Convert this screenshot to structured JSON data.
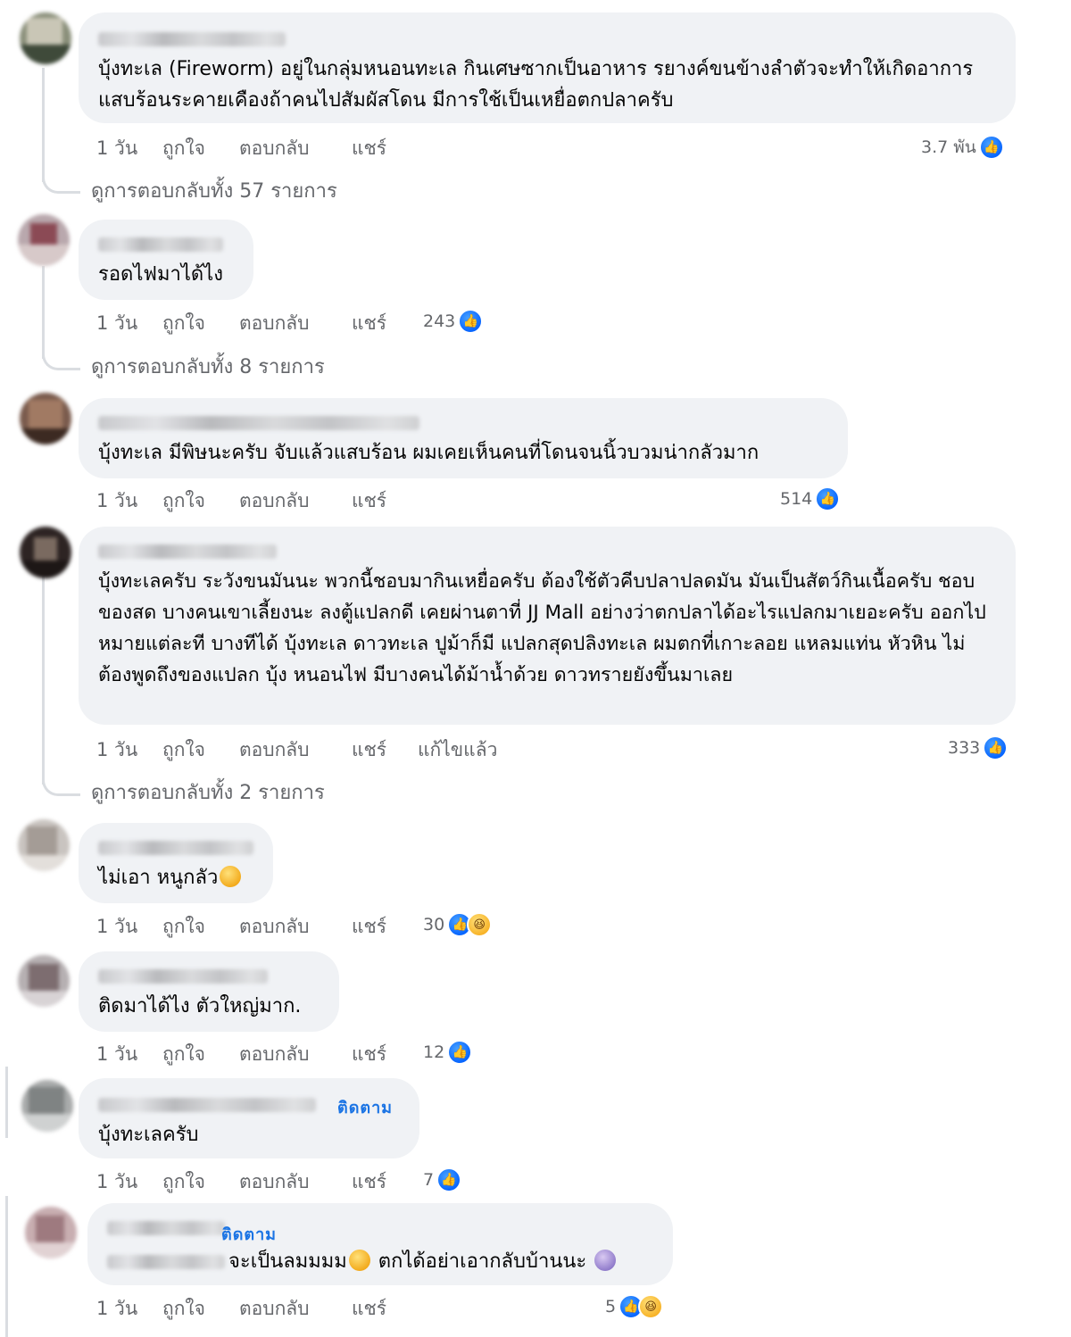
{
  "actions": {
    "time": "1 วัน",
    "like": "ถูกใจ",
    "reply": "ตอบกลับ",
    "share": "แชร์",
    "edited": "แก้ไขแล้ว"
  },
  "colors": {
    "bubble": "#f0f2f5",
    "accent": "#1b74e4",
    "muted_text": "#65676b",
    "like_blue": "#0866ff",
    "haha_yellow": "#f7b125"
  },
  "comments": [
    {
      "text": "บุ้งทะเล (Fireworm) อยู่ในกลุ่มหนอนทะเล กินเศษซากเป็นอาหาร รยางค์ขนข้างลำตัวจะทำให้เกิดอาการแสบร้อนระคายเคืองถ้าคนไปสัมผัสโดน มีการใช้เป็นเหยื่อตกปลาครับ",
      "reaction_count": "3.7 พัน",
      "reactions": [
        "like-icon"
      ],
      "view_replies": "ดูการตอบกลับทั้ง 57 รายการ"
    },
    {
      "text": "รอดไฟมาได้ไง",
      "reaction_count": "243",
      "reactions": [
        "like-icon"
      ],
      "view_replies": "ดูการตอบกลับทั้ง 8 รายการ"
    },
    {
      "text": "บุ้งทะเล มีพิษนะครับ จับแล้วแสบร้อน ผมเคยเห็นคนที่โดนจนนิ้วบวมน่ากลัวมาก",
      "reaction_count": "514",
      "reactions": [
        "like-icon"
      ]
    },
    {
      "text": "บุ้งทะเลครับ ระวังขนมันนะ พวกนี้ชอบมากินเหยื่อครับ ต้องใช้ตัวคีบปลาปลดมัน มันเป็นสัตว์กินเนื้อครับ ชอบของสด บางคนเขาเลี้ยงนะ ลงตู้แปลกดี เคยผ่านตาที่ JJ Mall อย่างว่าตกปลาได้อะไรแปลกมาเยอะครับ ออกไปหมายแต่ละที บางทีได้ บุ้งทะเล ดาวทะเล ปูม้าก็มี แปลกสุดปลิงทะเล ผมตกที่เกาะลอย แหลมแท่น หัวหิน ไม่ต้องพูดถึงของแปลก บุ้ง หนอนไฟ มีบางคนได้ม้าน้ำด้วย ดาวทรายยังขึ้นมาเลย",
      "reaction_count": "333",
      "reactions": [
        "like-icon"
      ],
      "edited": true,
      "view_replies": "ดูการตอบกลับทั้ง 2 รายการ"
    },
    {
      "text": "ไม่เอา หนูกลัว",
      "emoji_after": "rofl-emoji",
      "reaction_count": "30",
      "reactions": [
        "like-icon",
        "haha-icon"
      ]
    },
    {
      "text": "ติดมาได้ไง ตัวใหญ่มาก.",
      "reaction_count": "12",
      "reactions": [
        "like-icon"
      ]
    },
    {
      "text": "บุ้งทะเลครับ",
      "follow_label": "ติดตาม",
      "reaction_count": "7",
      "reactions": [
        "like-icon"
      ]
    },
    {
      "text_part1": "จะเป็นลมมมม",
      "text_part2": " ตกได้อย่าเอากลับบ้านนะ ",
      "follow_label": "ติดตาม",
      "reaction_count": "5",
      "reactions": [
        "like-icon",
        "haha-icon"
      ]
    }
  ]
}
